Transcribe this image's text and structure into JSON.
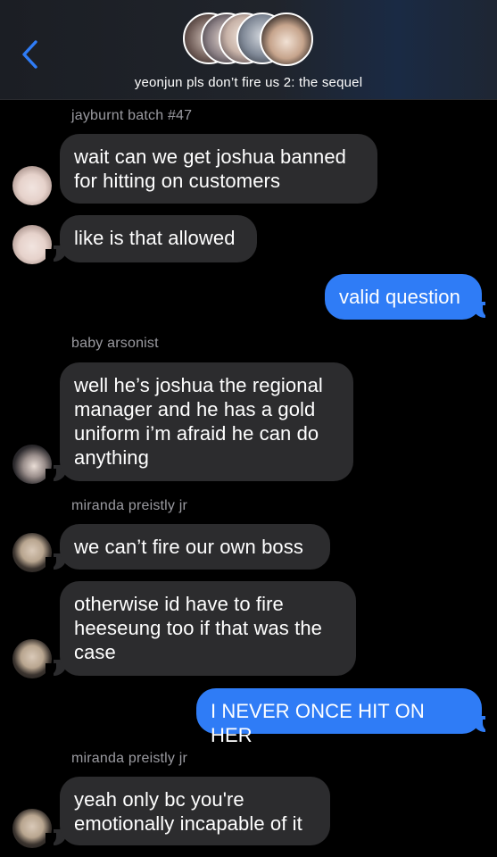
{
  "header": {
    "back_icon": "chevron-left-icon",
    "title": "yeonjun pls don’t fire us 2: the sequel",
    "accent": "#2f7cf6"
  },
  "messages": [
    {
      "sender": "jayburnt batch #47",
      "lines": [
        "wait can we get joshua banned",
        "for hitting on customers"
      ]
    },
    {
      "lines": [
        "like is that allowed"
      ]
    },
    {
      "lines": [
        "valid question"
      ]
    },
    {
      "sender": "baby arsonist",
      "lines": [
        "well he’s joshua the regional",
        "manager and he has a gold",
        "uniform i’m afraid he can do",
        "anything"
      ]
    },
    {
      "sender": "miranda preistly jr",
      "lines": [
        "we can’t fire our own boss"
      ]
    },
    {
      "lines": [
        "otherwise id have to fire",
        "heeseung too if that was the",
        "case"
      ]
    },
    {
      "lines": [
        "I NEVER ONCE HIT ON HER"
      ]
    },
    {
      "sender": "miranda preistly jr",
      "lines": [
        "yeah only bc you're",
        "emotionally incapable of it"
      ]
    }
  ]
}
